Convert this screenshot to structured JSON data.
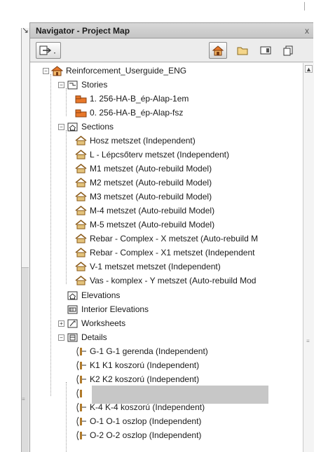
{
  "panel": {
    "title": "Navigator - Project Map",
    "close_glyph": "x"
  },
  "toolbar": {
    "buttons": [
      {
        "name": "view-map-icon",
        "active": false
      },
      {
        "name": "project-map-icon",
        "active": true
      },
      {
        "name": "layout-book-icon",
        "active": false
      },
      {
        "name": "publisher-sets-icon",
        "active": false
      },
      {
        "name": "view-map-alt-icon",
        "active": false
      }
    ]
  },
  "tree": {
    "root": "Reinforcement_Userguide_ENG",
    "stories": {
      "label": "Stories",
      "items": [
        "1. 256-HA-B_ép-Alap-1em",
        "0. 256-HA-B_ép-Alap-fsz"
      ]
    },
    "sections": {
      "label": "Sections",
      "items": [
        "Hosz metszet (Independent)",
        "L - Lépcsőterv metszet (Independent)",
        "M1 metszet (Auto-rebuild Model)",
        "M2 metszet (Auto-rebuild Model)",
        "M3 metszet (Auto-rebuild Model)",
        "M-4 metszet (Auto-rebuild Model)",
        "M-5 metszet (Auto-rebuild Model)",
        "Rebar - Complex - X metszet (Auto-rebuild M",
        "Rebar - Complex - X1 metszet (Independent",
        "V-1 metszet metszet (Independent)",
        "Vas - komplex - Y metszet (Auto-rebuild Mod"
      ]
    },
    "elevations": "Elevations",
    "interior_elevations": "Interior Elevations",
    "worksheets": "Worksheets",
    "details": {
      "label": "Details",
      "items": [
        "G-1 G-1 gerenda (Independent)",
        "K1 K1 koszorú (Independent)",
        "K2 K2 koszorú (Independent)",
        "",
        "K-4 K-4 koszorú (Independent)",
        "O-1 O-1 oszlop (Independent)",
        "O-2 O-2 oszlop (Independent)"
      ]
    }
  },
  "colors": {
    "story_orange": "#e8782a",
    "section_brown": "#b07a2a",
    "folder_tan": "#e3c27a",
    "redaction_gray": "#c7c7c7"
  }
}
